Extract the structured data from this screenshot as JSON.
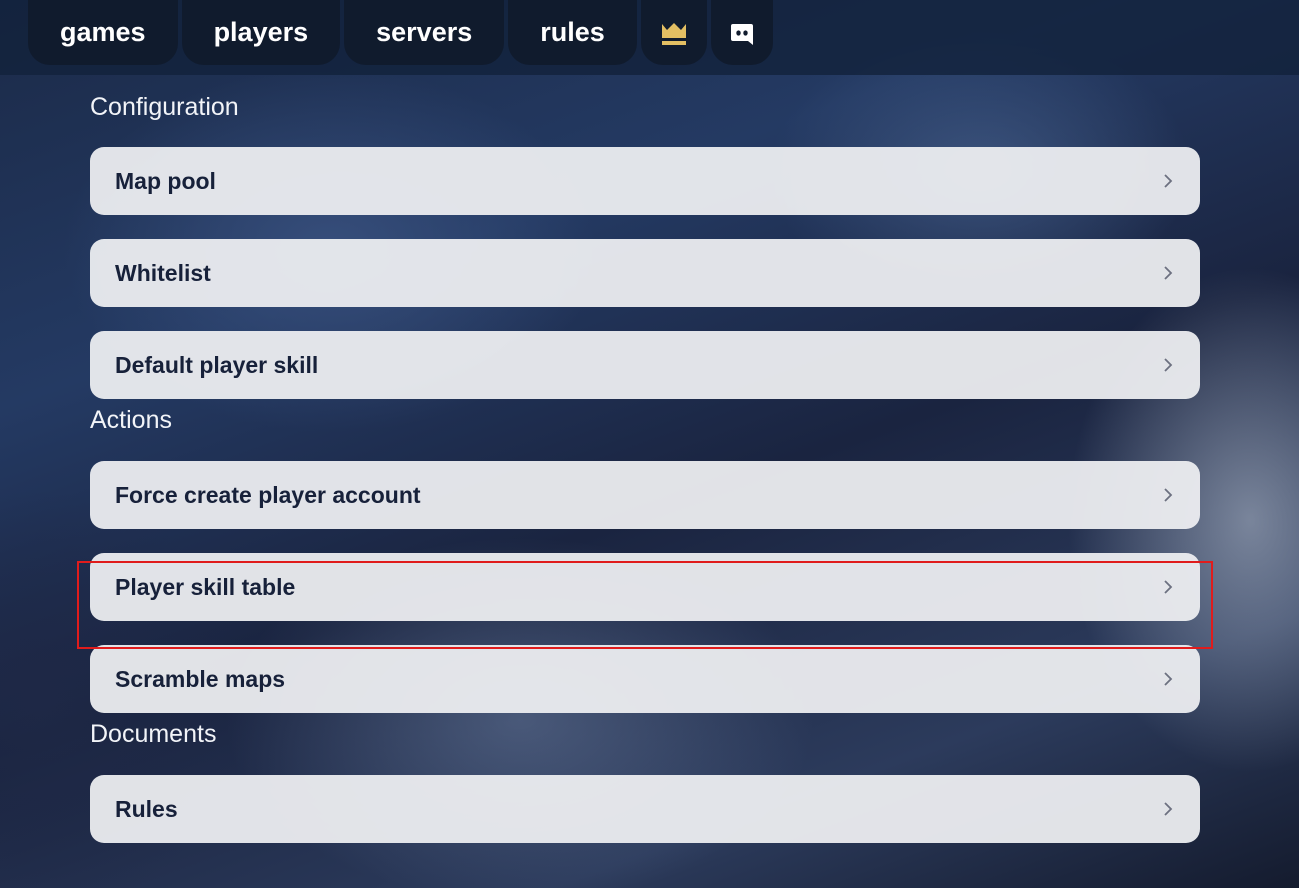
{
  "nav": {
    "items": [
      {
        "label": "games"
      },
      {
        "label": "players"
      },
      {
        "label": "servers"
      },
      {
        "label": "rules"
      }
    ],
    "icons": [
      "crown-icon",
      "discord-icon"
    ],
    "crown_color": "#e3bf63"
  },
  "sections": {
    "configuration": {
      "title": "Configuration",
      "items": [
        "Map pool",
        "Whitelist",
        "Default player skill"
      ]
    },
    "actions": {
      "title": "Actions",
      "items": [
        "Force create player account",
        "Player skill table",
        "Scramble maps"
      ]
    },
    "documents": {
      "title": "Documents",
      "items": [
        "Rules"
      ]
    }
  },
  "highlighted_item": "Player skill table",
  "colors": {
    "topbar": "#12223c",
    "nav_pill": "#101b2d",
    "card": "#ecedf0",
    "card_text": "#17213a",
    "highlight": "#e01c1c"
  }
}
